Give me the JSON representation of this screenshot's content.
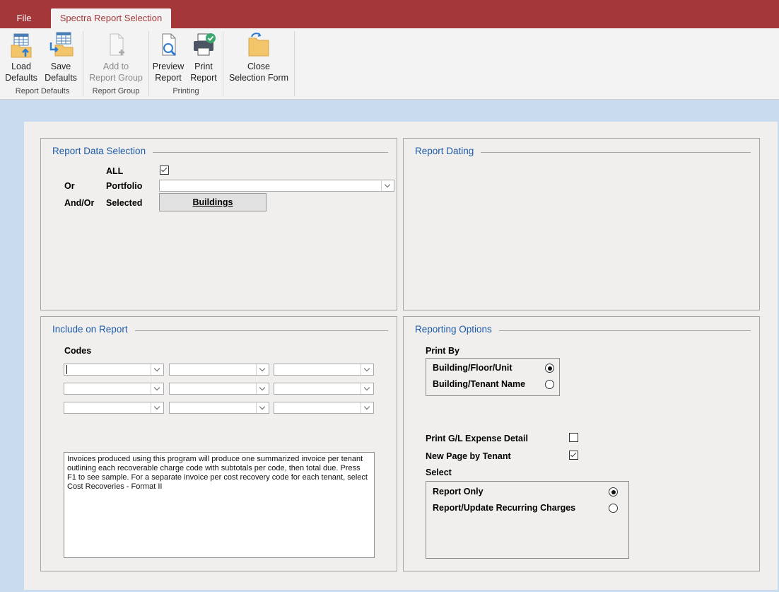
{
  "ribbon": {
    "tabs": [
      {
        "label": "File"
      },
      {
        "label": "Spectra Report Selection"
      }
    ],
    "buttons": {
      "load_defaults": {
        "line1": "Load",
        "line2": "Defaults"
      },
      "save_defaults": {
        "line1": "Save",
        "line2": "Defaults"
      },
      "add_to_report_group": {
        "line1": "Add to",
        "line2": "Report Group"
      },
      "preview_report": {
        "line1": "Preview",
        "line2": "Report"
      },
      "print_report": {
        "line1": "Print",
        "line2": "Report"
      },
      "close_selection_form": {
        "line1": "Close",
        "line2": "Selection Form"
      }
    },
    "groups": {
      "report_defaults": "Report Defaults",
      "report_group": "Report Group",
      "printing": "Printing"
    }
  },
  "data_selection": {
    "title": "Report Data Selection",
    "all_label": "ALL",
    "all_checked": true,
    "or_label": "Or",
    "portfolio_label": "Portfolio",
    "portfolio_value": "",
    "andor_label": "And/Or",
    "selected_label": "Selected",
    "buildings_button": "Buildings"
  },
  "report_dating": {
    "title": "Report Dating"
  },
  "include": {
    "title": "Include on Report",
    "codes_label": "Codes",
    "memo": "Invoices produced using this program will produce one summarized invoice per tenant outlining each recoverable charge code with subtotals per code, then total due. Press F1 to see sample. For a separate invoice per cost recovery code for each tenant, select Cost Recoveries - Format II"
  },
  "options": {
    "title": "Reporting Options",
    "print_by_label": "Print By",
    "print_by": [
      {
        "label": "Building/Floor/Unit",
        "selected": true
      },
      {
        "label": "Building/Tenant Name",
        "selected": false
      }
    ],
    "gl_detail_label": "Print G/L Expense Detail",
    "gl_detail_checked": false,
    "new_page_label": "New Page by Tenant",
    "new_page_checked": true,
    "select_label": "Select",
    "select": [
      {
        "label": "Report Only",
        "selected": true
      },
      {
        "label": "Report/Update Recurring Charges",
        "selected": false
      }
    ]
  }
}
